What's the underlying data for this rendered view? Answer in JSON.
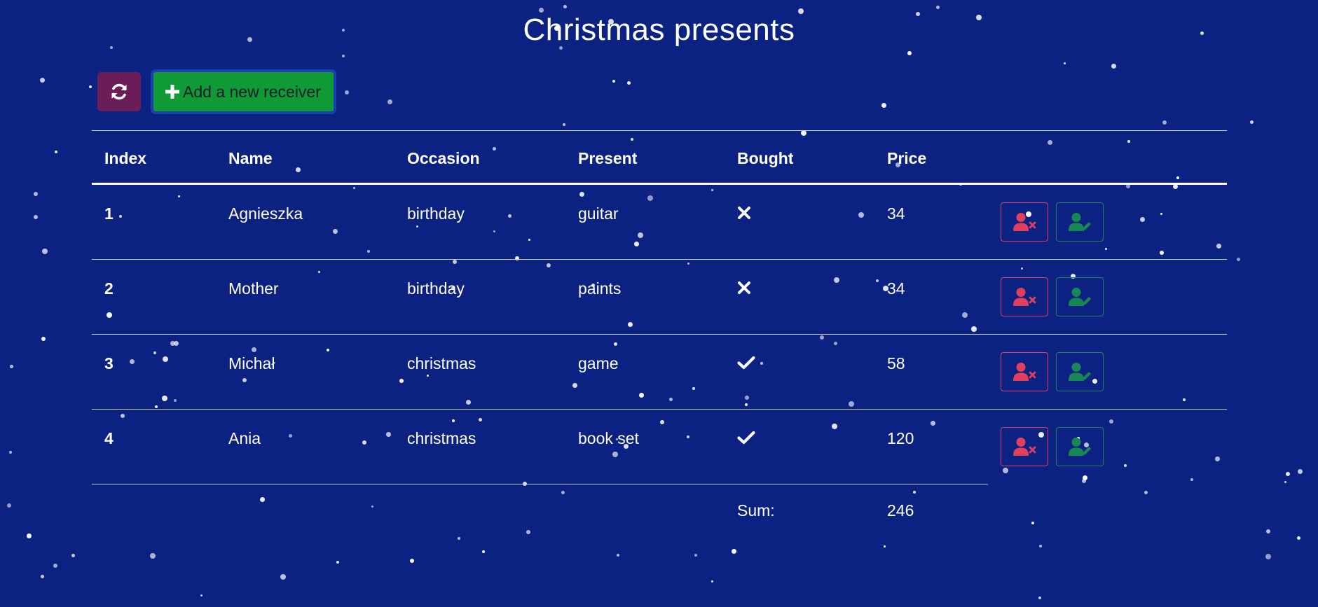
{
  "page": {
    "title": "Christmas presents",
    "background_color": "#0b2283"
  },
  "toolbar": {
    "refresh_icon": "refresh-icon",
    "refresh_color": "#6a1d56",
    "add_label": "Add a new receiver",
    "add_icon": "plus-icon",
    "add_color": "#0f9a36"
  },
  "table": {
    "headers": {
      "index": "Index",
      "name": "Name",
      "occasion": "Occasion",
      "present": "Present",
      "bought": "Bought",
      "price": "Price"
    },
    "rows": [
      {
        "index": "1",
        "name": "Agnieszka",
        "occasion": "birthday",
        "present": "guitar",
        "bought": false,
        "bought_icon": "cross-icon",
        "price": "34"
      },
      {
        "index": "2",
        "name": "Mother",
        "occasion": "birthday",
        "present": "paints",
        "bought": false,
        "bought_icon": "cross-icon",
        "price": "34"
      },
      {
        "index": "3",
        "name": "Michał",
        "occasion": "christmas",
        "present": "game",
        "bought": true,
        "bought_icon": "check-icon",
        "price": "58"
      },
      {
        "index": "4",
        "name": "Ania",
        "occasion": "christmas",
        "present": "book set",
        "bought": true,
        "bought_icon": "check-icon",
        "price": "120"
      }
    ],
    "row_actions": {
      "delete_icon": "user-remove-icon",
      "delete_color": "#e0405e",
      "edit_icon": "user-edit-icon",
      "edit_color": "#198754"
    },
    "footer": {
      "sum_label": "Sum:",
      "sum_value": "246"
    }
  }
}
